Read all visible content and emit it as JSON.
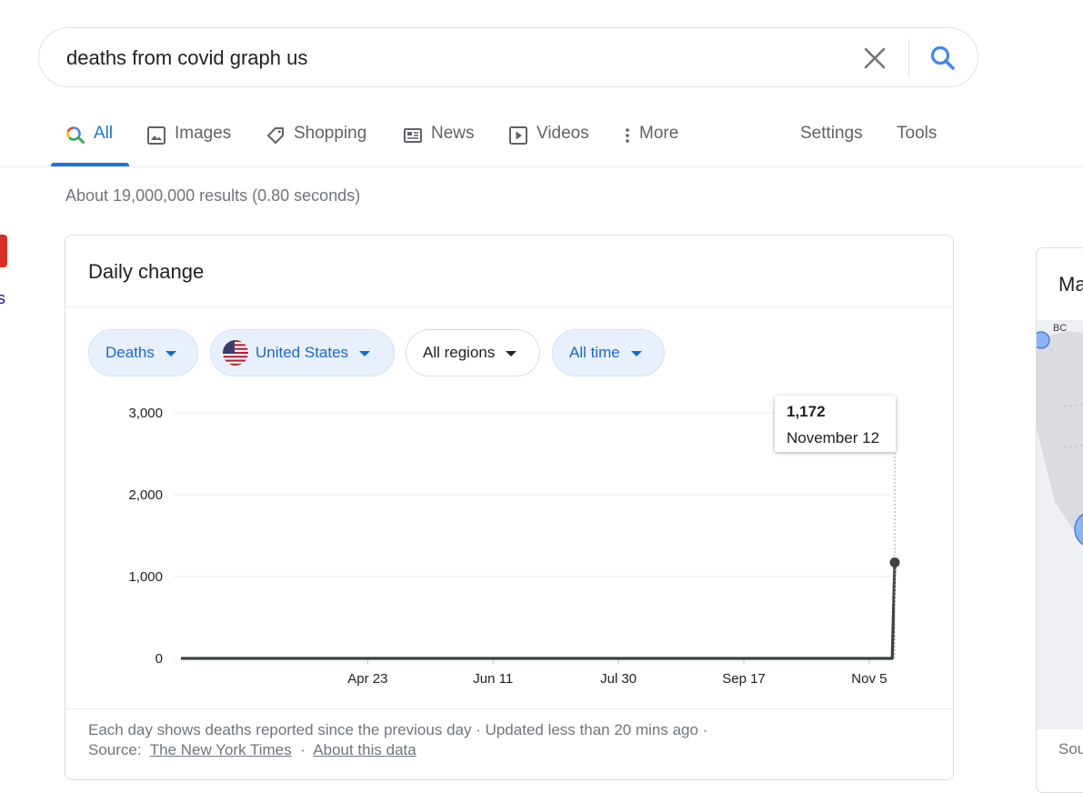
{
  "search": {
    "query": "deaths from covid graph us"
  },
  "tabs": [
    {
      "label": "All",
      "icon": "search-icon",
      "active": true
    },
    {
      "label": "Images",
      "icon": "image-icon"
    },
    {
      "label": "Shopping",
      "icon": "tag-icon"
    },
    {
      "label": "News",
      "icon": "newspaper-icon"
    },
    {
      "label": "Videos",
      "icon": "play-icon"
    },
    {
      "label": "More",
      "icon": "more-vertical-icon"
    },
    {
      "label": "Settings"
    },
    {
      "label": "Tools"
    }
  ],
  "result_stats": "About 19,000,000 results (0.80 seconds)",
  "card": {
    "title": "Daily change",
    "chips": [
      {
        "label": "Deaths",
        "style": "blue"
      },
      {
        "label": "United States",
        "style": "blue",
        "icon": "us-flag-icon"
      },
      {
        "label": "All regions",
        "style": "plain"
      },
      {
        "label": "All time",
        "style": "blue"
      }
    ],
    "tooltip": {
      "value": "1,172",
      "date": "November 12"
    },
    "footnote": "Each day shows deaths reported since the previous day · Updated less than 20 mins ago  ·",
    "source_label": "Source:",
    "source_link": "The New York Times",
    "separator": "·",
    "about_link": "About this data"
  },
  "right_panel": {
    "title": "Ma",
    "map_label": "BC",
    "footer": "Sou"
  },
  "left_fragment": "s",
  "colors": {
    "accent": "#1a73e8",
    "line": "#3c4043",
    "chip_bg": "#e8f0fe",
    "badge": "#d93025"
  },
  "chart_data": {
    "type": "area",
    "series": [
      {
        "name": "Deaths"
      }
    ],
    "y_ticks": [
      "0",
      "1,000",
      "2,000",
      "3,000"
    ],
    "x_ticks": [
      {
        "label": "Apr 23",
        "day": 73
      },
      {
        "label": "Jun 11",
        "day": 122
      },
      {
        "label": "Jul 30",
        "day": 171
      },
      {
        "label": "Sep 17",
        "day": 220
      },
      {
        "label": "Nov 5",
        "day": 269
      }
    ],
    "ylim": [
      0,
      3000
    ],
    "x_start": "2020-02-10",
    "x_end": "2020-11-12",
    "grid": true,
    "values": [
      0,
      0,
      0,
      0,
      0,
      0,
      0,
      0,
      0,
      0,
      0,
      0,
      0,
      0,
      0,
      0,
      0,
      0,
      0,
      0,
      0,
      0,
      0,
      0,
      0,
      0,
      0,
      0,
      0,
      0,
      0,
      0,
      0,
      0,
      0,
      0,
      0,
      0,
      0,
      0,
      0,
      0,
      0,
      0,
      0,
      0,
      0,
      0,
      0,
      0,
      0,
      0,
      0,
      0,
      0,
      0,
      0,
      0,
      0,
      0,
      0,
      0,
      0,
      0,
      0,
      0,
      0,
      0,
      0,
      0,
      0,
      0,
      0,
      0,
      0,
      0,
      0,
      0,
      0,
      0,
      0,
      0,
      0,
      0,
      0,
      0,
      0,
      0,
      0,
      0,
      0,
      0,
      0,
      0,
      0,
      0,
      0,
      0,
      0,
      0,
      0,
      0,
      0,
      0,
      0,
      0,
      0,
      0,
      0,
      0,
      0,
      0,
      0,
      0,
      0,
      0,
      0,
      0,
      0,
      0,
      0,
      0,
      0,
      0,
      0,
      0,
      0,
      0,
      0,
      0,
      0,
      0,
      0,
      0,
      0,
      0,
      0,
      0,
      0,
      0,
      0,
      0,
      0,
      0,
      0,
      0,
      0,
      0,
      0,
      0,
      0,
      0,
      0,
      0,
      0,
      0,
      0,
      0,
      0,
      0,
      0,
      0,
      0,
      0,
      0,
      0,
      0,
      0,
      0,
      0,
      0,
      0,
      0,
      0,
      0,
      0,
      0,
      0,
      0,
      0,
      0,
      0,
      0,
      0,
      0,
      0,
      0,
      0,
      0,
      0,
      0,
      0,
      0,
      0,
      0,
      0,
      0,
      0,
      0,
      0,
      0,
      0,
      0,
      0,
      0,
      0,
      0,
      0,
      0,
      0,
      0,
      0,
      0,
      0,
      0,
      0,
      0,
      0,
      0,
      0,
      0,
      0,
      0,
      0,
      0,
      0,
      0,
      0,
      0,
      0,
      0,
      0,
      0,
      0,
      0,
      0,
      0,
      0,
      0,
      0,
      0,
      0,
      0,
      0,
      0,
      0,
      0,
      0,
      0,
      0,
      0,
      0,
      0,
      0,
      0,
      0,
      0,
      0,
      0,
      0,
      0,
      0,
      0,
      0,
      0,
      0,
      0,
      0,
      0,
      0,
      0,
      0,
      0,
      0,
      0,
      0,
      0,
      0,
      0,
      1172
    ]
  }
}
